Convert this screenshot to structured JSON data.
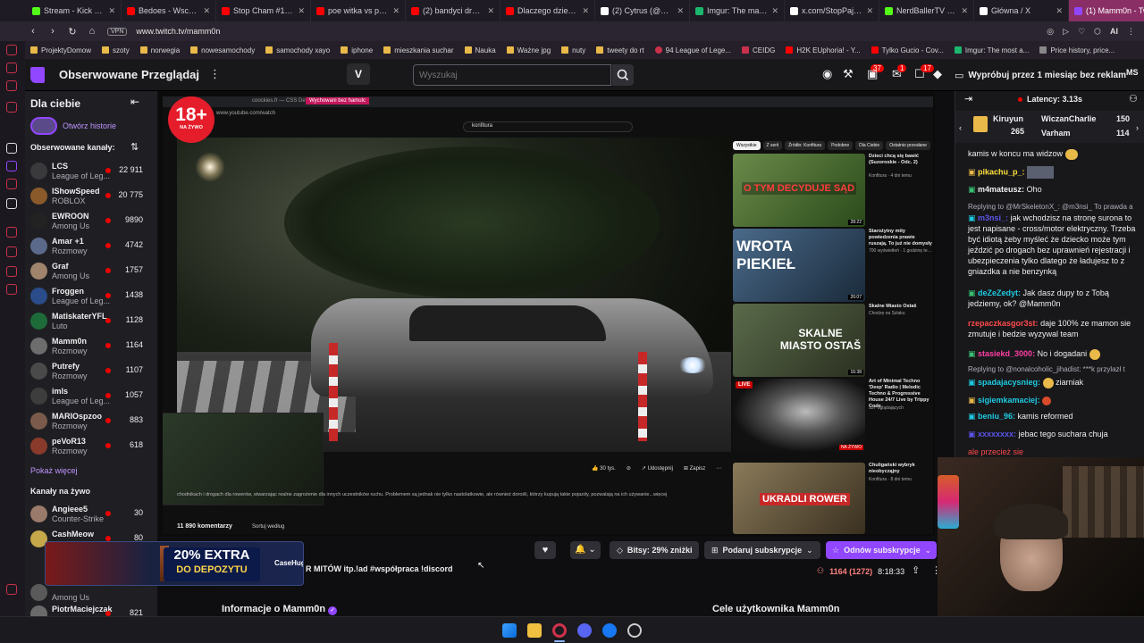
{
  "browser": {
    "tabs": [
      {
        "label": "Stream - Kick Dashb",
        "color": "#53fc18"
      },
      {
        "label": "Bedoes - Wschód",
        "color": "#ff0000"
      },
      {
        "label": "Stop Cham #1486",
        "color": "#ff0000"
      },
      {
        "label": "poe witka vs poe k",
        "color": "#ff0000"
      },
      {
        "label": "(2) bandyci drogow",
        "color": "#ff0000"
      },
      {
        "label": "Dlaczego dziewczy",
        "color": "#ff0000"
      },
      {
        "label": "(2) Cytrus (@Cytr",
        "color": "#ffffff"
      },
      {
        "label": "Imgur: The magic o",
        "color": "#1bb76e"
      },
      {
        "label": "x.com/StopPajalo",
        "color": "#ffffff"
      },
      {
        "label": "NerdBallerTV Strea",
        "color": "#53fc18"
      },
      {
        "label": "Główna / X",
        "color": "#ffffff"
      },
      {
        "label": "(1) Mamm0n - Twitch",
        "color": "#9146ff",
        "active": true
      }
    ],
    "url": "www.twitch.tv/mamm0n",
    "vpn_label": "VPN",
    "ai_label": "AI",
    "bookmarks": [
      "ProjektyDomow",
      "szoty",
      "norwegia",
      "nowesamochody",
      "samochody xayo",
      "iphone",
      "mieszkania suchar",
      "Nauka",
      "Ważne jpg",
      "nuty",
      "tweety do rt",
      "94 League of Lege...",
      "CEIDG",
      "H2K EUphoria! - Y...",
      "Tylko Gucio - Cov...",
      "Imgur: The most a...",
      "Price history, price..."
    ]
  },
  "topnav": {
    "following": "Obserwowane",
    "browse": "Przeglądaj",
    "search_placeholder": "Wyszukaj",
    "badge_drops": "37",
    "badge_messages": "1",
    "badge_notifications": "17",
    "promo": "Wypróbuj przez 1 miesiąc bez reklam",
    "user_initials": "MS"
  },
  "sidebar": {
    "title": "Dla ciebie",
    "history": "Otwórz historie",
    "followed_header": "Obserwowane kanały:",
    "channels": [
      {
        "name": "LCS",
        "game": "League of Leg...",
        "viewers": "22 911",
        "color": "#3a3a3d"
      },
      {
        "name": "IShowSpeed",
        "game": "ROBLOX",
        "viewers": "20 775",
        "color": "#8b5a2b"
      },
      {
        "name": "EWROON",
        "game": "Among Us",
        "viewers": "9890",
        "color": "#222"
      },
      {
        "name": "Amar +1",
        "game": "Rozmowy",
        "viewers": "4742",
        "color": "#5b6a8a"
      },
      {
        "name": "Graf",
        "game": "Among Us",
        "viewers": "1757",
        "color": "#a0846c"
      },
      {
        "name": "Froggen",
        "game": "League of Leg...",
        "viewers": "1438",
        "color": "#2b4c8a"
      },
      {
        "name": "MatiskaterYFL",
        "game": "Luto",
        "viewers": "1128",
        "color": "#1e6b3a"
      },
      {
        "name": "Mamm0n",
        "game": "Rozmowy",
        "viewers": "1164",
        "color": "#6d6d6d"
      },
      {
        "name": "Putrefy",
        "game": "Rozmowy",
        "viewers": "1107",
        "color": "#4a4a4a"
      },
      {
        "name": "imls",
        "game": "League of Leg...",
        "viewers": "1057",
        "color": "#3d3d3d"
      },
      {
        "name": "MARIOspzoo",
        "game": "Rozmowy",
        "viewers": "883",
        "color": "#7a5a4a"
      },
      {
        "name": "peVoR13",
        "game": "Rozmowy",
        "viewers": "618",
        "color": "#8a3a2a"
      }
    ],
    "show_more": "Pokaż więcej",
    "live_header": "Kanały na żywo",
    "live_channels": [
      {
        "name": "Angieee5",
        "game": "Counter-Strike",
        "viewers": "30",
        "color": "#9a7a6a"
      },
      {
        "name": "CashMeow",
        "game": "",
        "viewers": "80",
        "color": "#c5a84a"
      },
      {
        "name": "",
        "game": "Among Us",
        "viewers": "",
        "color": "#5a5a5a"
      },
      {
        "name": "PiotrMaciejczak",
        "game": "",
        "viewers": "821",
        "color": "#6a6a6a"
      }
    ]
  },
  "player": {
    "age_badge": "18+",
    "live_label": "NA ŻYWO",
    "yt_url": "www.youtube.com/watch",
    "yt_search": "konfitura",
    "yt_tab1": "Wychowani bez hamulc",
    "yt_tab2": "coockies.fr — CSS Demo",
    "yt_chips": [
      "Wszystkie",
      "Z serii",
      "Źródło: Konfitura",
      "Podobne",
      "Dla Ciebie",
      "Ostatnio przesłane"
    ],
    "video_likes": "30 tys.",
    "share_label": "Udostępnij",
    "save_label": "Zapisz",
    "comments_count": "11 890 komentarzy",
    "sort_label": "Sortuj według",
    "description": "chodnikach i drogach dla rowerów, stwarzając realne zagrożenie dla innych uczestników ruchu. Problemem są jednak nie tylko nastolatkowie, ale również dorośli, którzy kupują takie pojazdy, pozwalają na ich używanie...więcej",
    "recommendations": [
      {
        "thumb_text": "O TYM DECYDUJE SĄD",
        "title": "Dzieci chcą się bawić (Suzoroskie - Odc. 2)",
        "meta": "Konfitura · 4 dni temu",
        "duration": "28:22",
        "color": "#3a6a2a"
      },
      {
        "thumb_text": "WROTA PIEKIEŁ",
        "title": "Starożytny mity powiedzenia prawie ruszają. To już nie domysły",
        "meta": "700 wyświetleń · 1 godzinę temu",
        "duration": "26:07",
        "color": "#3a4e6a"
      },
      {
        "thumb_text": "SKALNE MIASTO OSTAŠ",
        "title": "Skalne Miasto Ostaš",
        "meta": "Chodzę na Szlaku",
        "duration": "16:38",
        "color": "#4a5a3a"
      },
      {
        "thumb_text": "",
        "title": "Art of Minimal Techno 'Deep' Radio | Melodic Techno & Progressive House 24/7 Live by Trippy Code",
        "meta": "127 oglądających",
        "duration": "NA ŻYWO",
        "live_badge": "LIVE",
        "color": "#2a2a2a"
      },
      {
        "thumb_text": "UKRADLI ROWER",
        "title": "Chuligański wybryk nieobycząjny",
        "meta": "Konfitura · 8 dni temu",
        "duration": "",
        "color": "#6a5a3a"
      }
    ]
  },
  "info": {
    "ad_top": "20% EXTRA",
    "ad_bottom": "DO DEPOZYTU",
    "ad_brand": "CaseHug",
    "stream_title": "R MITÓW itp.!ad #współpraca !discord",
    "bits_label": "Bitsy: 29% zniżki",
    "gift_label": "Podaruj subskrypcje",
    "resub_label": "Odnów subskrypcje",
    "viewers": "1164 (1272)",
    "uptime": "8:18:33",
    "about_label": "Informacje o Mamm0n",
    "goals_label": "Cele użytkownika Mamm0n"
  },
  "chat": {
    "latency": "Latency: 3.13s",
    "leaderboard": [
      {
        "name": "Kiruyun",
        "value": "265"
      },
      {
        "name": "WiczanCharlie...",
        "value": "150"
      },
      {
        "name": "Varham",
        "value": "114"
      }
    ],
    "messages": [
      {
        "user": "",
        "user_color": "#efeff1",
        "text": "kamis w koncu ma widzow"
      },
      {
        "user": "pikachu_p_:",
        "user_color": "#ffe23d",
        "text": ""
      },
      {
        "user": "m4mateusz:",
        "user_color": "#efeff1",
        "text": "Oho"
      },
      {
        "user": "",
        "user_color": "#adadb8",
        "text": "Replying to @MrSkeletonX_: @m3nsi_ To prawda a"
      },
      {
        "user": "m3nsi_:",
        "user_color": "#5b54e8",
        "text": "jak wchodzisz na stronę surona to jest napisane - cross/motor elektryczny. Trzeba być idiotą żeby myśleć że dziecko może tym jeździć po drogach bez uprawnień rejestracji i ubezpieczenia tylko dlatego że ładujesz to z gniazdka a nie benzynką"
      },
      {
        "user": "deZeZedyt:",
        "user_color": "#1ecbe1",
        "text": "Jak dasz dupy to z Tobą jedziemy, ok? @Mamm0n"
      },
      {
        "user": "rzepaczkasgor3st:",
        "user_color": "#ff4a4a",
        "text": "daje 100% ze mamon sie zmutuje i bedzie wyzywal team"
      },
      {
        "user": "stasiekd_3000:",
        "user_color": "#ff3fa4",
        "text": "No i dogadani"
      },
      {
        "user": "",
        "user_color": "#adadb8",
        "text": "Replying to @nonalcoholic_jihadist: ***k przylazł t"
      },
      {
        "user": "spadajacysnieg:",
        "user_color": "#1ecbe1",
        "text": "ziarniak"
      },
      {
        "user": "sigiemkamaciej:",
        "user_color": "#1ecbe1",
        "text": ""
      },
      {
        "user": "beniu_96:",
        "user_color": "#1ecbe1",
        "text": "kamis reformed"
      },
      {
        "user": "xxxxxxxx:",
        "user_color": "#5b54e8",
        "text": "jebac tego suchara chuja"
      },
      {
        "user": "",
        "user_color": "#ff4a4a",
        "text": "ale przecież sie"
      }
    ]
  },
  "colors": {
    "twitch_purple": "#9146ff",
    "live_red": "#eb0400",
    "opera_red": "#c9314b"
  },
  "icons": [
    "search-icon",
    "heart-icon",
    "bell-icon",
    "gift-icon",
    "share-icon",
    "more-icon",
    "collapse-icon",
    "sort-icon",
    "windows-icon",
    "folder-icon",
    "opera-icon",
    "discord-icon",
    "messenger-icon",
    "steam-icon"
  ]
}
